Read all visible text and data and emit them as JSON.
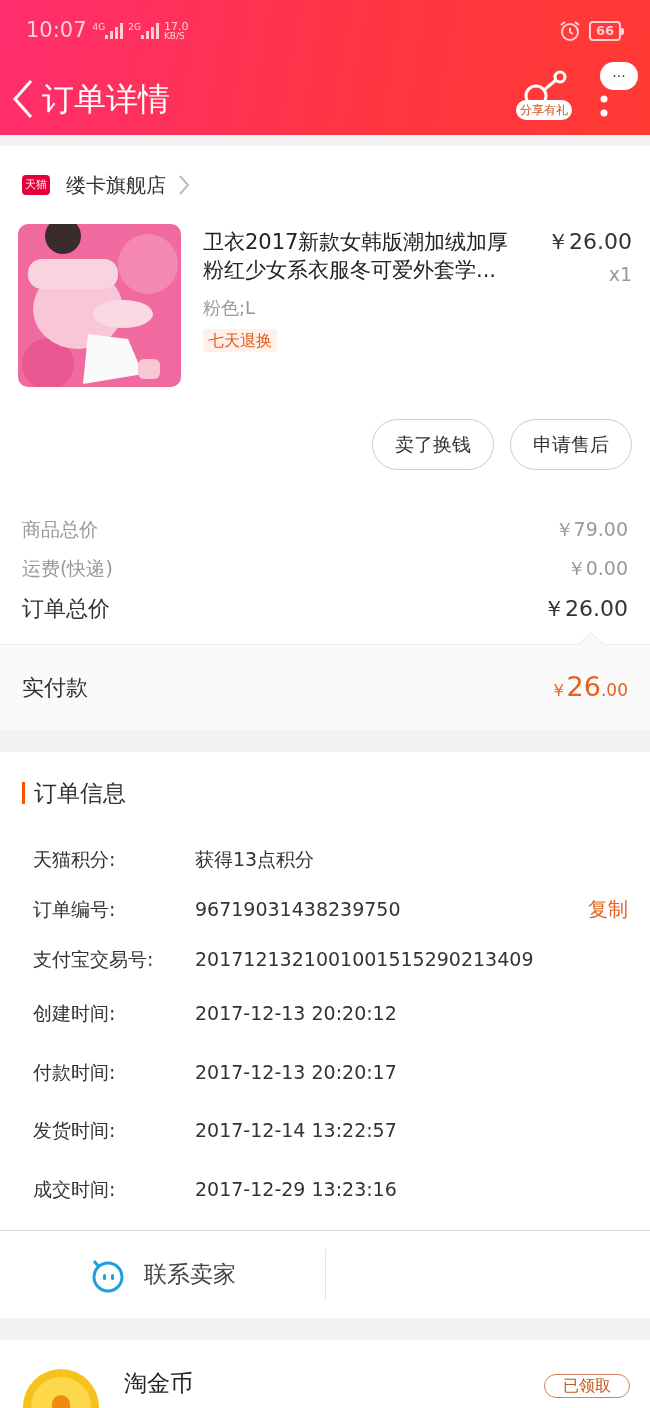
{
  "status_bar": {
    "time": "10:07",
    "network_1": "4G",
    "network_2": "2G",
    "speed": "17.0",
    "speed_unit": "KB/S",
    "battery": "66"
  },
  "header": {
    "title": "订单详情",
    "share_label": "分享有礼",
    "more": "···"
  },
  "store": {
    "badge": "天猫",
    "name": "缕卡旗舰店"
  },
  "product": {
    "title": "卫衣2017新款女韩版潮加绒加厚粉红少女系衣服冬可爱外套学...",
    "price": "￥26.00",
    "quantity": "x1",
    "variant": "粉色;L",
    "tag": "七天退换"
  },
  "actions": [
    "卖了换钱",
    "申请售后"
  ],
  "summary": [
    {
      "label": "商品总价",
      "value": "￥79.00",
      "kind": "minor"
    },
    {
      "label": "运费(快递)",
      "value": "￥0.00",
      "kind": "minor"
    },
    {
      "label": "订单总价",
      "value": "￥26.00",
      "kind": "major"
    }
  ],
  "paid": {
    "label": "实付款",
    "currency": "￥",
    "integer": "26",
    "decimal": ".00"
  },
  "order_info": {
    "title": "订单信息",
    "rows": [
      {
        "label": "天猫积分:",
        "value": "获得13点积分"
      },
      {
        "label": "订单编号:",
        "value": "96719031438239750",
        "action": "复制"
      },
      {
        "label": "支付宝交易号:",
        "value": "2017121321001001515290213409"
      },
      {
        "label": "创建时间:",
        "value": "2017-12-13 20:20:12"
      },
      {
        "label": "付款时间:",
        "value": "2017-12-13 20:20:17"
      },
      {
        "label": "发货时间:",
        "value": "2017-12-14 13:22:57"
      },
      {
        "label": "成交时间:",
        "value": "2017-12-29 13:23:16"
      }
    ]
  },
  "contact": {
    "label": "联系卖家"
  },
  "coins": {
    "title": "淘金币",
    "button": "已领取"
  }
}
